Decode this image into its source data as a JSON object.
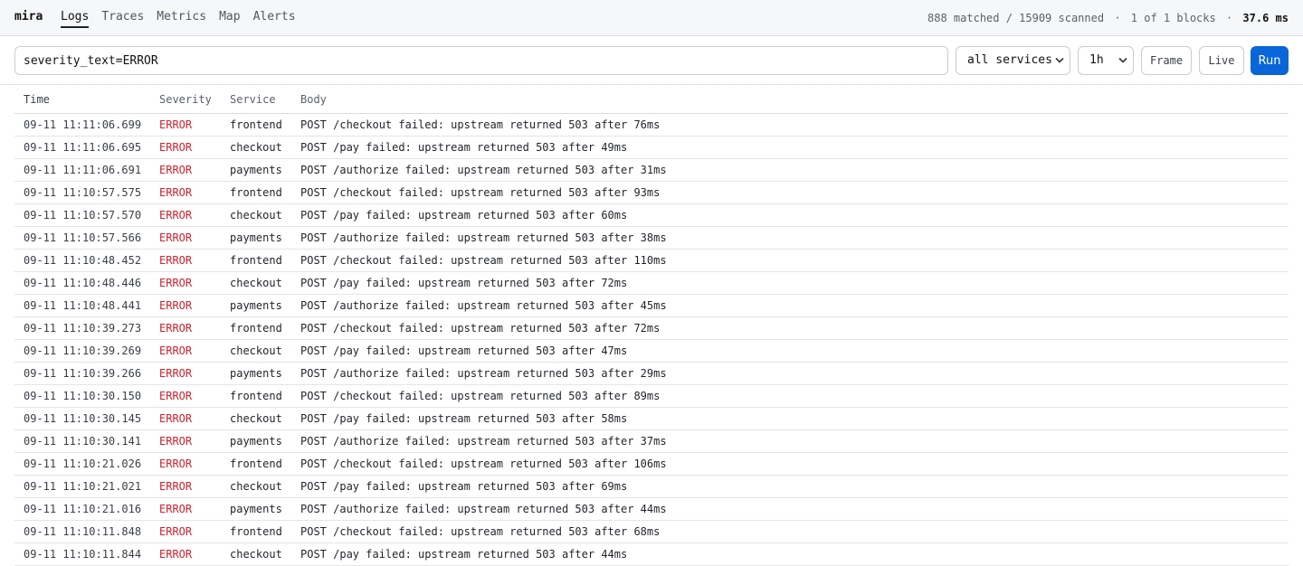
{
  "app": {
    "brand": "mira",
    "nav": [
      {
        "label": "Logs",
        "active": true
      },
      {
        "label": "Traces",
        "active": false
      },
      {
        "label": "Metrics",
        "active": false
      },
      {
        "label": "Map",
        "active": false
      },
      {
        "label": "Alerts",
        "active": false
      }
    ],
    "stats": {
      "matched": "888 matched / 15909 scanned",
      "blocks": "1 of 1 blocks",
      "latency": "37.6 ms",
      "separator": "·"
    }
  },
  "toolbar": {
    "query_value": "severity_text=ERROR",
    "service_select": "all services",
    "range_select": "1h",
    "frame_label": "Frame",
    "live_label": "Live",
    "run_label": "Run",
    "chevron_icon": "chevron-down-icon"
  },
  "colors": {
    "accent": "#0a66d8",
    "error": "#cf222e"
  },
  "table": {
    "columns": [
      "Time",
      "Severity",
      "Service",
      "Body"
    ],
    "rows": [
      {
        "time": "09-11 11:11:06.699",
        "severity": "ERROR",
        "service": "frontend",
        "body": "POST /checkout failed: upstream returned 503 after 76ms"
      },
      {
        "time": "09-11 11:11:06.695",
        "severity": "ERROR",
        "service": "checkout",
        "body": "POST /pay failed: upstream returned 503 after 49ms"
      },
      {
        "time": "09-11 11:11:06.691",
        "severity": "ERROR",
        "service": "payments",
        "body": "POST /authorize failed: upstream returned 503 after 31ms"
      },
      {
        "time": "09-11 11:10:57.575",
        "severity": "ERROR",
        "service": "frontend",
        "body": "POST /checkout failed: upstream returned 503 after 93ms"
      },
      {
        "time": "09-11 11:10:57.570",
        "severity": "ERROR",
        "service": "checkout",
        "body": "POST /pay failed: upstream returned 503 after 60ms"
      },
      {
        "time": "09-11 11:10:57.566",
        "severity": "ERROR",
        "service": "payments",
        "body": "POST /authorize failed: upstream returned 503 after 38ms"
      },
      {
        "time": "09-11 11:10:48.452",
        "severity": "ERROR",
        "service": "frontend",
        "body": "POST /checkout failed: upstream returned 503 after 110ms"
      },
      {
        "time": "09-11 11:10:48.446",
        "severity": "ERROR",
        "service": "checkout",
        "body": "POST /pay failed: upstream returned 503 after 72ms"
      },
      {
        "time": "09-11 11:10:48.441",
        "severity": "ERROR",
        "service": "payments",
        "body": "POST /authorize failed: upstream returned 503 after 45ms"
      },
      {
        "time": "09-11 11:10:39.273",
        "severity": "ERROR",
        "service": "frontend",
        "body": "POST /checkout failed: upstream returned 503 after 72ms"
      },
      {
        "time": "09-11 11:10:39.269",
        "severity": "ERROR",
        "service": "checkout",
        "body": "POST /pay failed: upstream returned 503 after 47ms"
      },
      {
        "time": "09-11 11:10:39.266",
        "severity": "ERROR",
        "service": "payments",
        "body": "POST /authorize failed: upstream returned 503 after 29ms"
      },
      {
        "time": "09-11 11:10:30.150",
        "severity": "ERROR",
        "service": "frontend",
        "body": "POST /checkout failed: upstream returned 503 after 89ms"
      },
      {
        "time": "09-11 11:10:30.145",
        "severity": "ERROR",
        "service": "checkout",
        "body": "POST /pay failed: upstream returned 503 after 58ms"
      },
      {
        "time": "09-11 11:10:30.141",
        "severity": "ERROR",
        "service": "payments",
        "body": "POST /authorize failed: upstream returned 503 after 37ms"
      },
      {
        "time": "09-11 11:10:21.026",
        "severity": "ERROR",
        "service": "frontend",
        "body": "POST /checkout failed: upstream returned 503 after 106ms"
      },
      {
        "time": "09-11 11:10:21.021",
        "severity": "ERROR",
        "service": "checkout",
        "body": "POST /pay failed: upstream returned 503 after 69ms"
      },
      {
        "time": "09-11 11:10:21.016",
        "severity": "ERROR",
        "service": "payments",
        "body": "POST /authorize failed: upstream returned 503 after 44ms"
      },
      {
        "time": "09-11 11:10:11.848",
        "severity": "ERROR",
        "service": "frontend",
        "body": "POST /checkout failed: upstream returned 503 after 68ms"
      },
      {
        "time": "09-11 11:10:11.844",
        "severity": "ERROR",
        "service": "checkout",
        "body": "POST /pay failed: upstream returned 503 after 44ms"
      }
    ]
  }
}
